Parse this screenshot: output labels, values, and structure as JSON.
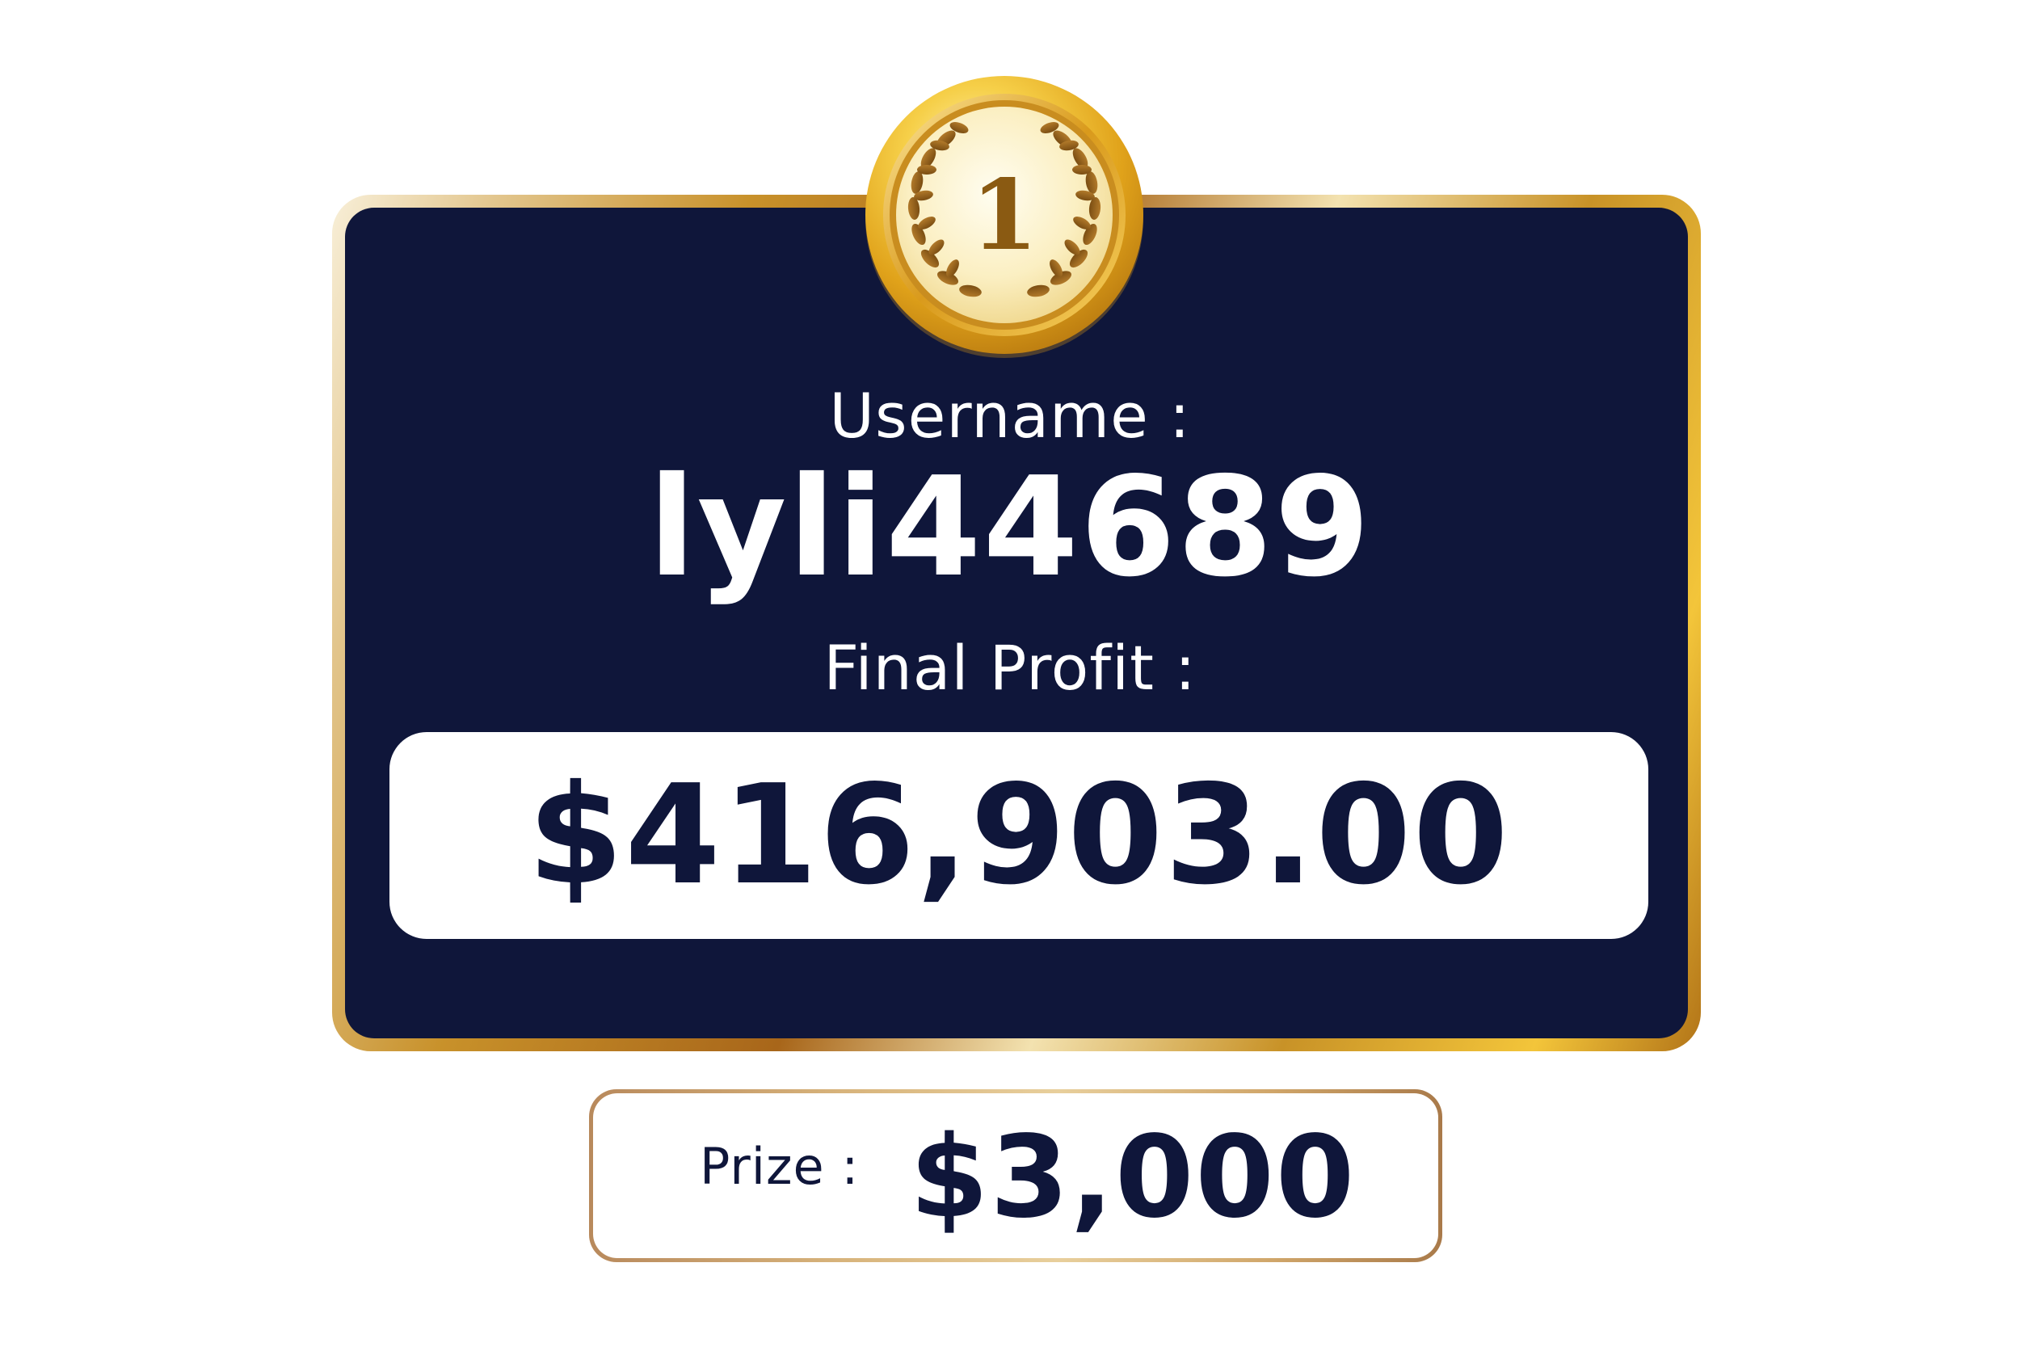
{
  "card": {
    "rank": "1",
    "username_label": "Username :",
    "username": "lyli44689",
    "profit_label": "Final Profit :",
    "profit_value": "$416,903.00"
  },
  "prize": {
    "label": "Prize :",
    "value": "$3,000"
  },
  "icons": {
    "medal": "gold-medal-laurel-icon"
  },
  "colors": {
    "navy": "#0f163a",
    "gold": "#d4a437",
    "white": "#ffffff"
  }
}
